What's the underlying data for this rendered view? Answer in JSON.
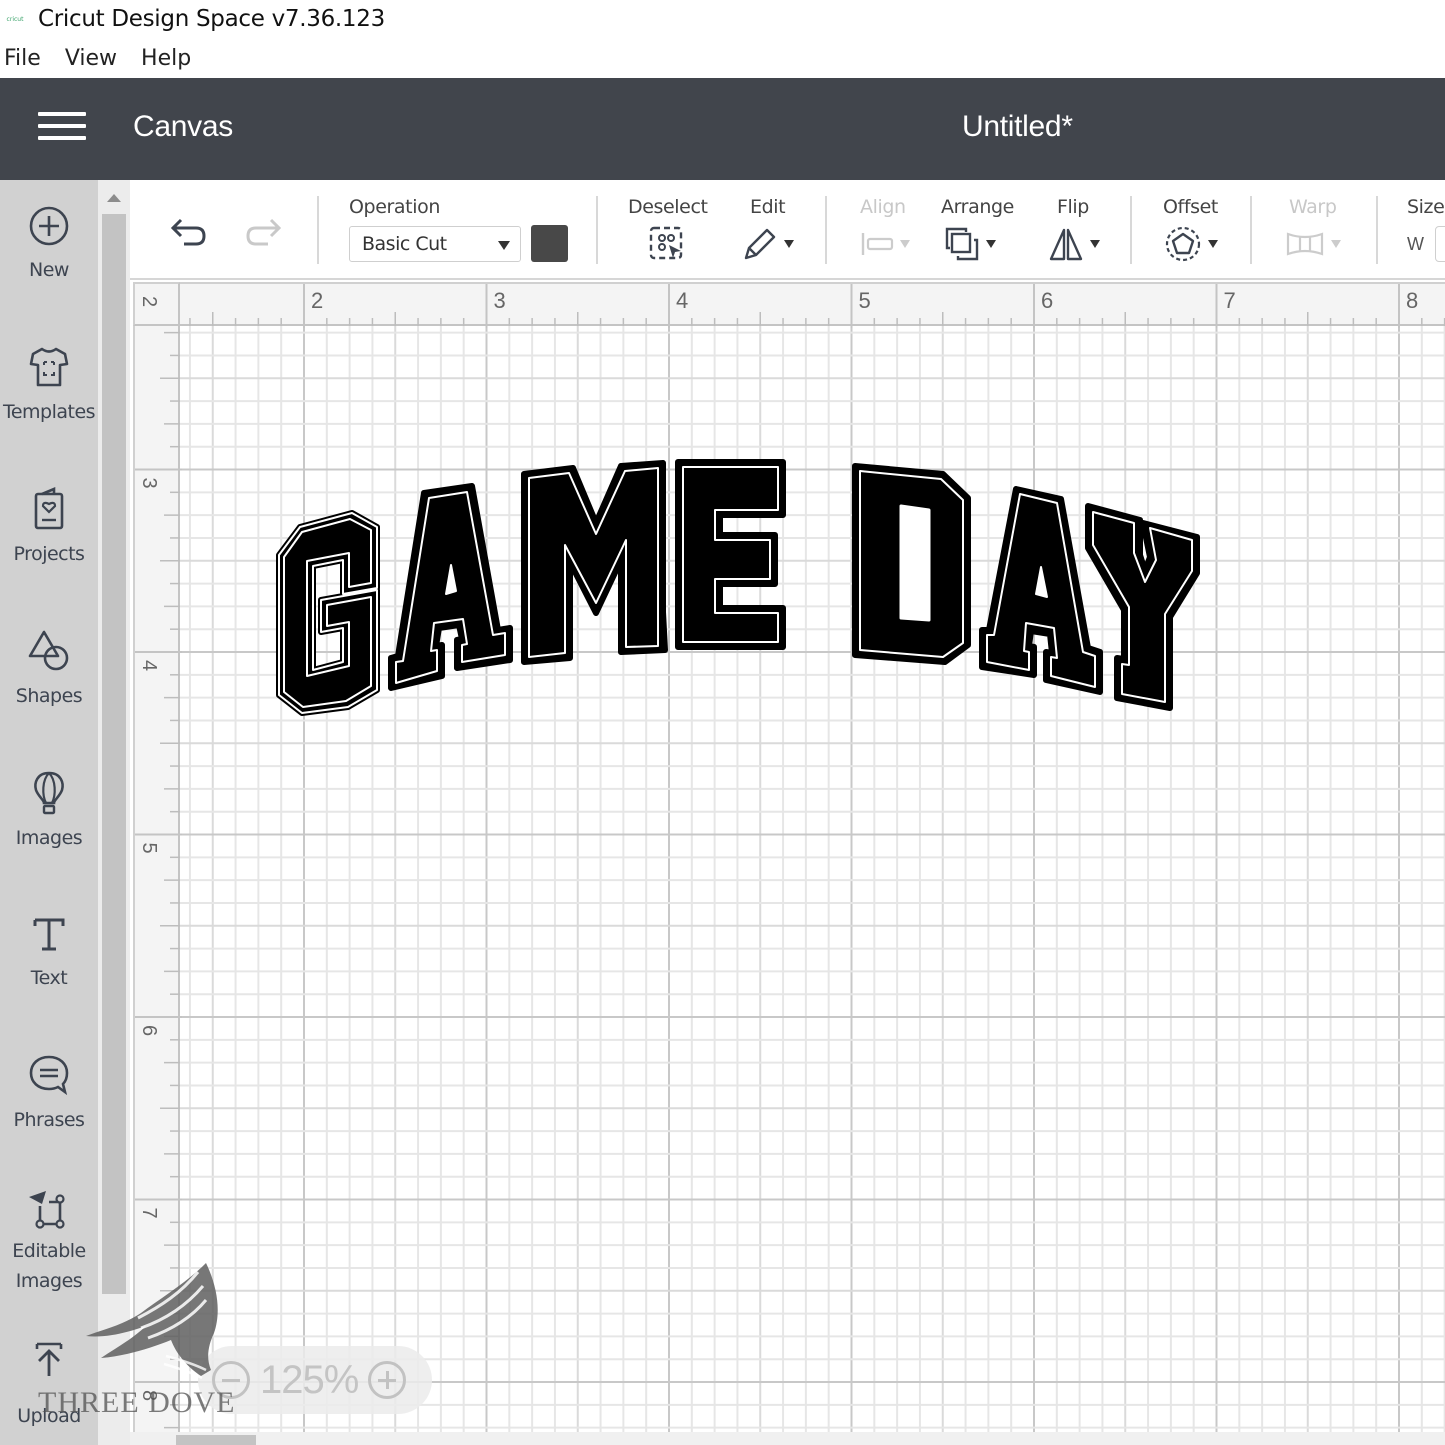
{
  "window": {
    "app_logo": "cricut",
    "title": "Cricut Design Space  v7.36.123"
  },
  "menubar": {
    "items": [
      "File",
      "View",
      "Help"
    ]
  },
  "header": {
    "section": "Canvas",
    "document_title": "Untitled*"
  },
  "sidebar": {
    "items": [
      {
        "label": "New",
        "icon": "plus-circle-icon"
      },
      {
        "label": "Templates",
        "icon": "tshirt-icon"
      },
      {
        "label": "Projects",
        "icon": "card-heart-icon"
      },
      {
        "label": "Shapes",
        "icon": "shapes-icon"
      },
      {
        "label": "Images",
        "icon": "hot-air-balloon-icon"
      },
      {
        "label": "Text",
        "icon": "text-t-icon"
      },
      {
        "label": "Phrases",
        "icon": "speech-bubble-icon"
      },
      {
        "label": "Editable",
        "label2": "Images",
        "icon": "editable-images-icon"
      },
      {
        "label": "Upload",
        "icon": "upload-icon"
      }
    ]
  },
  "toolbar": {
    "undo": "undo-icon",
    "redo": "redo-icon",
    "operation_label": "Operation",
    "operation_value": "Basic Cut",
    "operation_color": "#484848",
    "deselect_label": "Deselect",
    "edit_label": "Edit",
    "align_label": "Align",
    "arrange_label": "Arrange",
    "flip_label": "Flip",
    "offset_label": "Offset",
    "warp_label": "Warp",
    "size_label": "Size",
    "size_w_label": "W",
    "size_w_value": ""
  },
  "canvas": {
    "ruler_top": [
      "2",
      "3",
      "4",
      "5",
      "6",
      "7",
      "8"
    ],
    "ruler_left": [
      "2",
      "3",
      "4",
      "5",
      "6",
      "7",
      "8"
    ],
    "corner_label": "2",
    "design_text": "GAME DAY",
    "design_fill": "#000000",
    "design_outline": "#ffffff"
  },
  "zoom": {
    "value": "125%"
  },
  "watermark": {
    "text": "THREE DOVE"
  }
}
